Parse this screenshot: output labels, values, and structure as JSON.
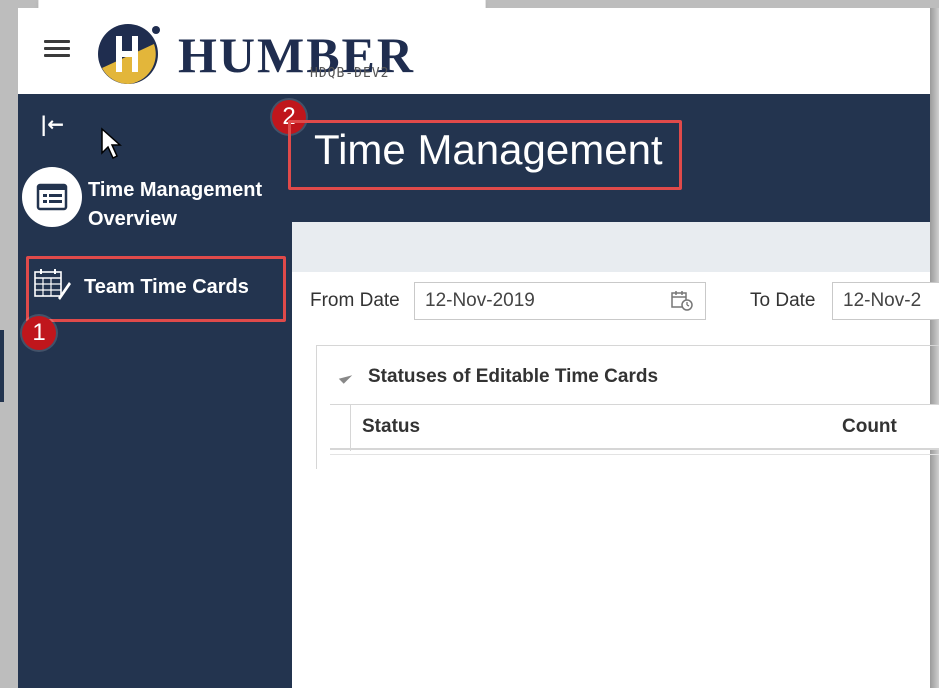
{
  "header": {
    "brand": "HUMBER",
    "environment": "HDQB-DEV2"
  },
  "sidebar": {
    "items": [
      {
        "label": "Time Management Overview",
        "icon": "list-icon"
      },
      {
        "label": "Team Time Cards",
        "icon": "calendar-grid-icon"
      }
    ]
  },
  "page": {
    "title": "Time Management"
  },
  "filters": {
    "from_label": "From Date",
    "from_value": "12-Nov-2019",
    "to_label": "To Date",
    "to_value": "12-Nov-2"
  },
  "panel": {
    "title": "Statuses of Editable Time Cards",
    "columns": [
      "Status",
      "Count"
    ]
  },
  "callouts": {
    "one": "1",
    "two": "2"
  },
  "colors": {
    "nav_bg": "#23344f",
    "callout_red": "#c0161c",
    "highlight_border": "#e04a4a",
    "brand_navy": "#1f2d4f",
    "brand_gold": "#e3b63a"
  }
}
